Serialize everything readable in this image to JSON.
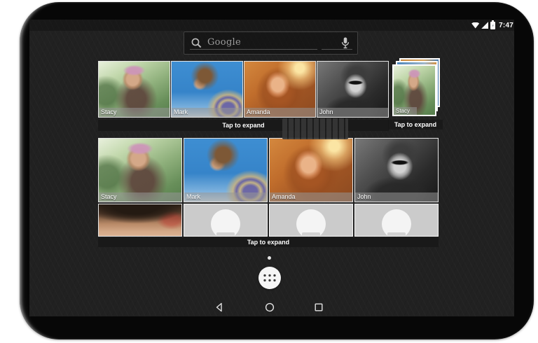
{
  "status_bar": {
    "time": "7:47",
    "wifi_icon": "wifi",
    "signal_icon": "cell-signal",
    "battery_icon": "battery"
  },
  "search": {
    "logo_text": "Google",
    "search_icon": "magnifier",
    "mic_icon": "microphone"
  },
  "widgets": {
    "strip": {
      "people": [
        "Stacy",
        "Mark",
        "Amanda",
        "John"
      ],
      "expand_label": "Tap to expand"
    },
    "stack": {
      "person": "Stacy",
      "expand_label": "Tap to expand"
    },
    "grid": {
      "people": [
        "Stacy",
        "Mark",
        "Amanda",
        "John"
      ],
      "expand_label": "Tap to expand"
    }
  },
  "nav": {
    "back_icon": "back-triangle",
    "home_icon": "home-circle",
    "recents_icon": "recents-square",
    "app_drawer_icon": "app-grid"
  },
  "colors": {
    "wallpaper": "#212121",
    "expand_bar": "#191919",
    "placeholder_tile": "#cbcbcb",
    "name_bar": "rgba(150,150,150,0.55)",
    "search_border": "#414141",
    "time_text": "#ffffff"
  }
}
